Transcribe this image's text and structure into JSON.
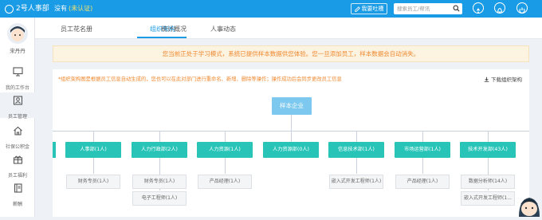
{
  "app": {
    "name": "2号人事部"
  },
  "header": {
    "company": "没有",
    "certification": "(未认证)",
    "feedback_label": "我要吐槽",
    "search_placeholder": "搜索员工/帮讯"
  },
  "user": {
    "name": "宋丹丹"
  },
  "sidebar": {
    "items": [
      {
        "label": "我的工作台",
        "icon": "monitor-icon"
      },
      {
        "label": "员工管理",
        "icon": "employee-icon",
        "active": true
      },
      {
        "label": "社保公积金",
        "icon": "home-icon"
      },
      {
        "label": "员工福利",
        "icon": "gift-icon"
      },
      {
        "label": "薪酬",
        "icon": "book-icon"
      }
    ]
  },
  "tabs": [
    {
      "label": "员工花名册"
    },
    {
      "label": "组织架构",
      "active": true
    },
    {
      "label": "统计概况"
    },
    {
      "label": "人事动态"
    }
  ],
  "notice": "您当前正处于学习模式，系统已提供样本数据供您体验。您一旦添加员工，样本数据会自动消失。",
  "org": {
    "hint": "*组织架构图是根据员工信息自动生成的，您也可以在此对部门进行重命名、新增、删除等操作；操作成功后会同步更改员工信息",
    "download_label": "下载组织架构",
    "root": "样本企业",
    "departments": [
      {
        "name": "人事部(1人)",
        "positions": [
          "财务专员(1人)"
        ]
      },
      {
        "name": "人力行政部(2人)",
        "positions": [
          "财务专员(1人)",
          "电子工程师(1人)"
        ]
      },
      {
        "name": "人力资源(1人)",
        "positions": [
          "产品经理(1人)"
        ]
      },
      {
        "name": "人力资源部(0人)",
        "positions": []
      },
      {
        "name": "信息技术部(1人)",
        "positions": [
          "嵌入式开发工程师(1人)"
        ]
      },
      {
        "name": "市场运营部(1人)",
        "positions": [
          "产品经理(1人)"
        ]
      },
      {
        "name": "技术开发部(43人)",
        "positions": [
          "数据分析师(14人)",
          "嵌入式开发工程师(1..."
        ]
      }
    ]
  },
  "colors": {
    "primary": "#1a9be6",
    "dept": "#28c4b8",
    "root": "#7cc8ee",
    "warning": "#f0882e",
    "notice_bg": "#fdf3e1"
  }
}
